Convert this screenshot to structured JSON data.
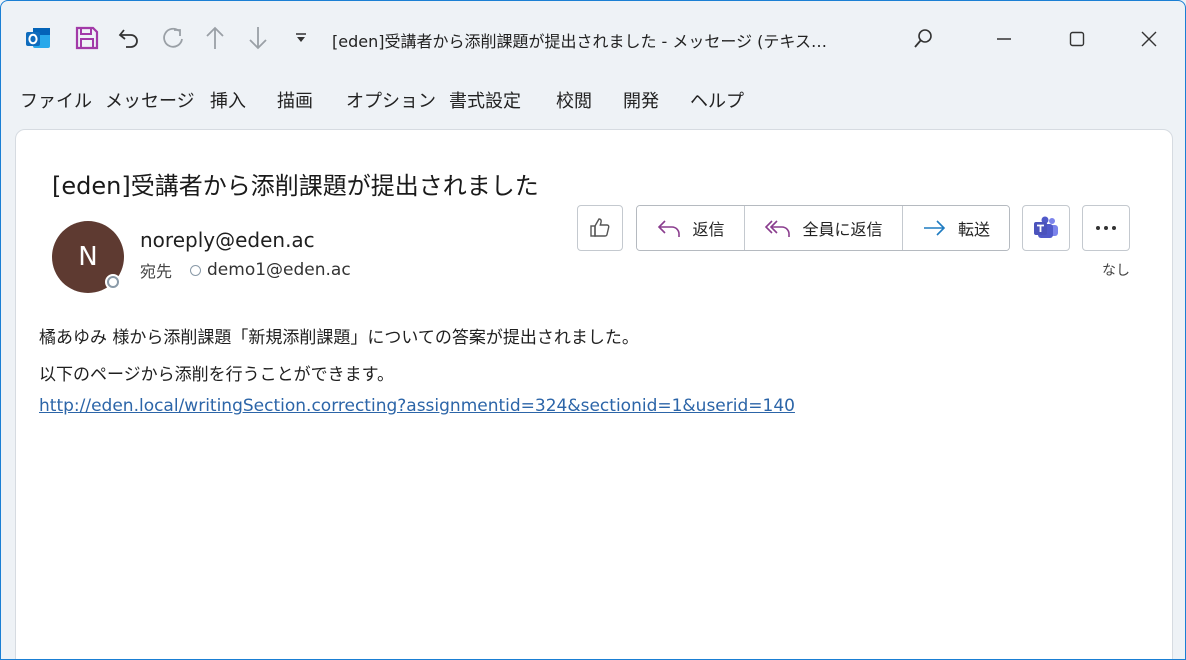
{
  "window": {
    "title": "[eden]受講者から添削課題が提出されました  -  メッセージ (テキス…",
    "accent": "#1a7fd4"
  },
  "toolbar": {
    "icons": [
      "outlook-icon",
      "save-icon",
      "undo-icon",
      "redo-icon",
      "up-arrow-icon",
      "down-arrow-icon",
      "customize-dropdown-icon"
    ]
  },
  "menu": {
    "items": [
      "ファイル",
      "メッセージ",
      "挿入",
      "描画",
      "オプション",
      "書式設定",
      "校閲",
      "開発",
      "ヘルプ"
    ]
  },
  "message": {
    "subject": "[eden]受講者から添削課題が提出されました",
    "avatar_initial": "N",
    "avatar_color": "#5e3a31",
    "sender": "noreply@eden.ac",
    "to_label": "宛先",
    "to_address": "demo1@eden.ac",
    "reply_label": "返信",
    "reply_all_label": "全員に返信",
    "forward_label": "転送",
    "sensitivity_label": "なし",
    "body_line1": "橘あゆみ 様から添削課題「新規添削課題」についての答案が提出されました。",
    "body_line2": "以下のページから添削を行うことができます。",
    "body_link": "http://eden.local/writingSection.correcting?assignmentid=324&sectionid=1&userid=140"
  }
}
